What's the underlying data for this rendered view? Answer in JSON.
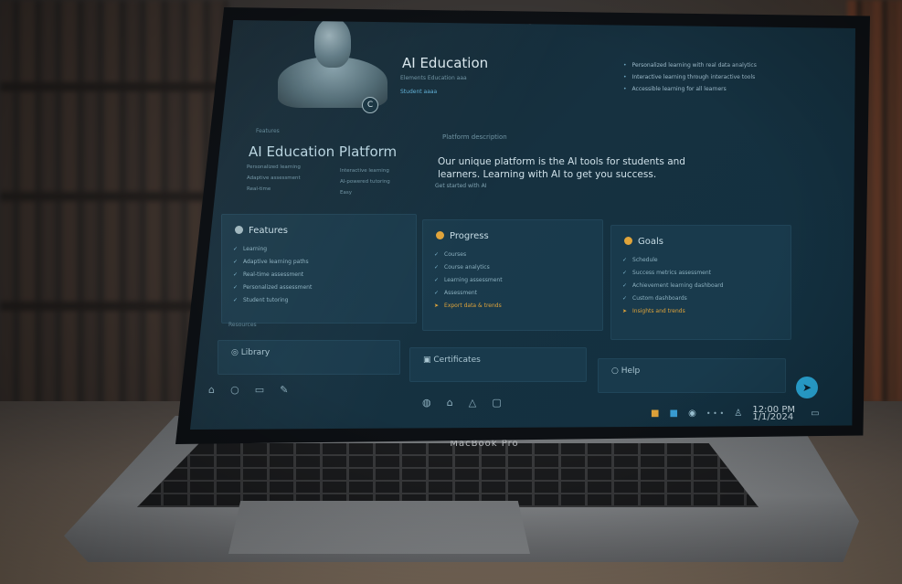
{
  "app": {
    "title": "AI Education",
    "subtitle": "Elements Education aaa",
    "link": "Student aaaa"
  },
  "hero": {
    "badge": "C"
  },
  "top_bullets": [
    "Personalized learning with real data analytics",
    "Interactive learning through interactive tools",
    "Accessible learning for all learners"
  ],
  "overview": {
    "heading": "Features",
    "title": "AI Education Platform",
    "col_a": [
      "Personalized learning",
      "Adaptive assessment",
      "Real-time"
    ],
    "col_b": [
      "Interactive learning",
      "AI-powered tutoring",
      "Easy"
    ]
  },
  "description": {
    "label": "Platform description",
    "text": "Our unique platform is the AI tools for students and learners. Learning with AI to get you success.",
    "note": "Get started with AI"
  },
  "cards": [
    {
      "title": "Features",
      "icon_color": "#9fb6be",
      "items": [
        "Learning",
        "Adaptive learning paths",
        "Real-time assessment",
        "Personalized assessment",
        "Student tutoring"
      ],
      "accent": ""
    },
    {
      "title": "Progress",
      "icon_color": "#e0a43a",
      "items": [
        "Courses",
        "Course analytics",
        "Learning assessment",
        "Assessment"
      ],
      "accent": "Export data & trends"
    },
    {
      "title": "Goals",
      "icon_color": "#e0a43a",
      "items": [
        "Schedule",
        "Success metrics assessment",
        "Achievement learning dashboard",
        "Custom dashboards"
      ],
      "accent": "Insights and trends"
    }
  ],
  "bottom": {
    "label": "Resources",
    "cards": [
      "Library",
      "Certificates",
      "Help"
    ]
  },
  "dock": {
    "left_icons": [
      "home-icon",
      "search-icon",
      "folder-icon",
      "pen-icon"
    ],
    "center_icons": [
      "shield-icon",
      "store-icon",
      "user-icon",
      "calendar-icon"
    ]
  },
  "tray": {
    "time": "12:00 PM",
    "date": "1/1/2024"
  },
  "laptop": {
    "brand": "MacBook Pro"
  },
  "colors": {
    "accent": "#2aa8d8",
    "warning": "#e0a43a",
    "screen": "#163140"
  }
}
